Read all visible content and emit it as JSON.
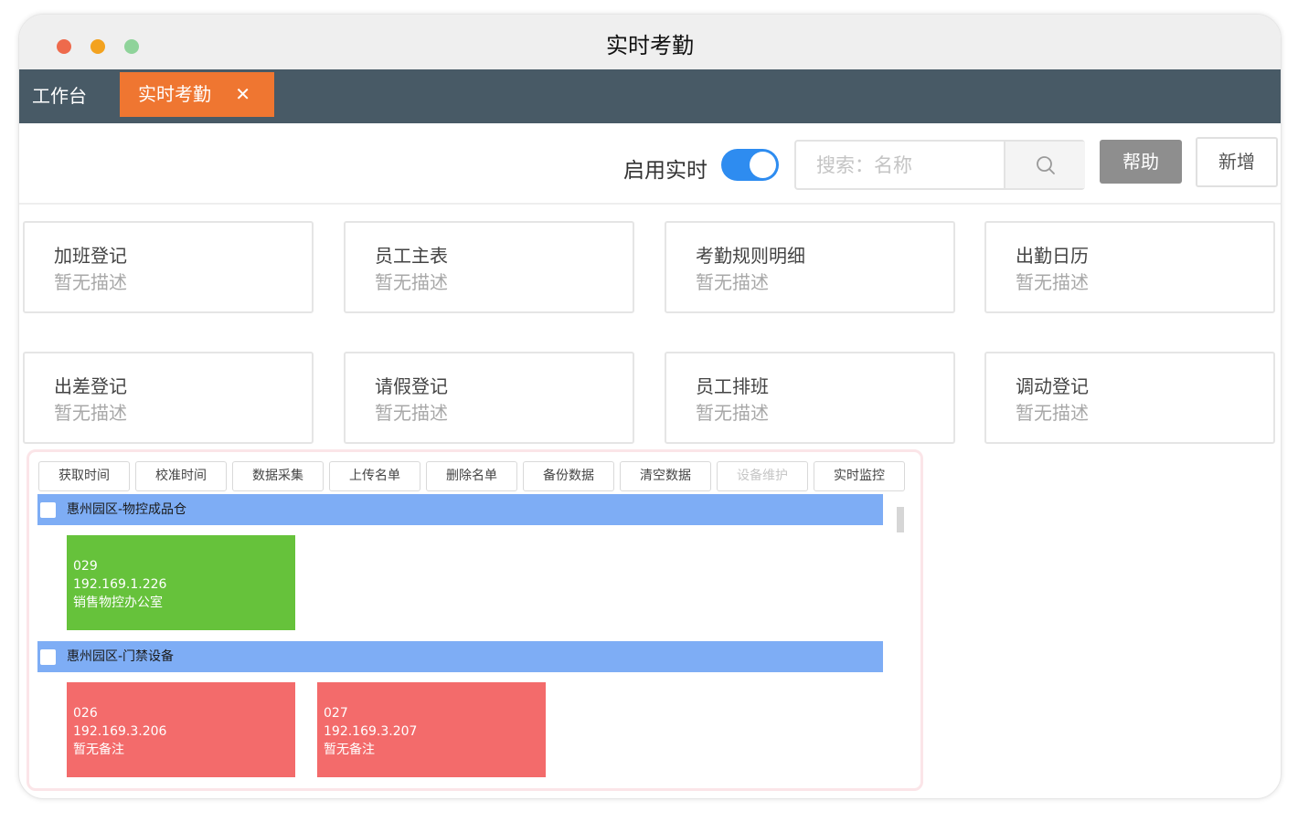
{
  "window": {
    "title": "实时考勤"
  },
  "tabs": {
    "home": "工作台",
    "active": "实时考勤",
    "close_glyph": "✕"
  },
  "toolbar": {
    "realtime_label": "启用实时",
    "realtime_enabled": true,
    "search_placeholder": "搜索：名称",
    "search_value": "",
    "help_label": "帮助",
    "add_label": "新增"
  },
  "cards": [
    {
      "title": "加班登记",
      "desc": "暂无描述"
    },
    {
      "title": "员工主表",
      "desc": "暂无描述"
    },
    {
      "title": "考勤规则明细",
      "desc": "暂无描述"
    },
    {
      "title": "出勤日历",
      "desc": "暂无描述"
    },
    {
      "title": "出差登记",
      "desc": "暂无描述"
    },
    {
      "title": "请假登记",
      "desc": "暂无描述"
    },
    {
      "title": "员工排班",
      "desc": "暂无描述"
    },
    {
      "title": "调动登记",
      "desc": "暂无描述"
    }
  ],
  "device_ops": [
    {
      "label": "获取时间",
      "enabled": true
    },
    {
      "label": "校准时间",
      "enabled": true
    },
    {
      "label": "数据采集",
      "enabled": true
    },
    {
      "label": "上传名单",
      "enabled": true
    },
    {
      "label": "删除名单",
      "enabled": true
    },
    {
      "label": "备份数据",
      "enabled": true
    },
    {
      "label": "清空数据",
      "enabled": true
    },
    {
      "label": "设备维护",
      "enabled": false
    },
    {
      "label": "实时监控",
      "enabled": true
    }
  ],
  "groups": [
    {
      "name": "惠州园区-物控成品仓",
      "devices": [
        {
          "id": "029",
          "ip": "192.169.1.226",
          "note": "销售物控办公室",
          "status_color": "#66c23b"
        }
      ]
    },
    {
      "name": "惠州园区-门禁设备",
      "devices": [
        {
          "id": "026",
          "ip": "192.169.3.206",
          "note": "暂无备注",
          "status_color": "#f36b6b"
        },
        {
          "id": "027",
          "ip": "192.169.3.207",
          "note": "暂无备注",
          "status_color": "#f36b6b"
        }
      ]
    }
  ],
  "colors": {
    "accent_tab": "#ef7631",
    "tabbar": "#485a66",
    "toggle": "#2e8cf0",
    "group_bar": "#7eadf5",
    "online": "#66c23b",
    "offline": "#f36b6b"
  }
}
